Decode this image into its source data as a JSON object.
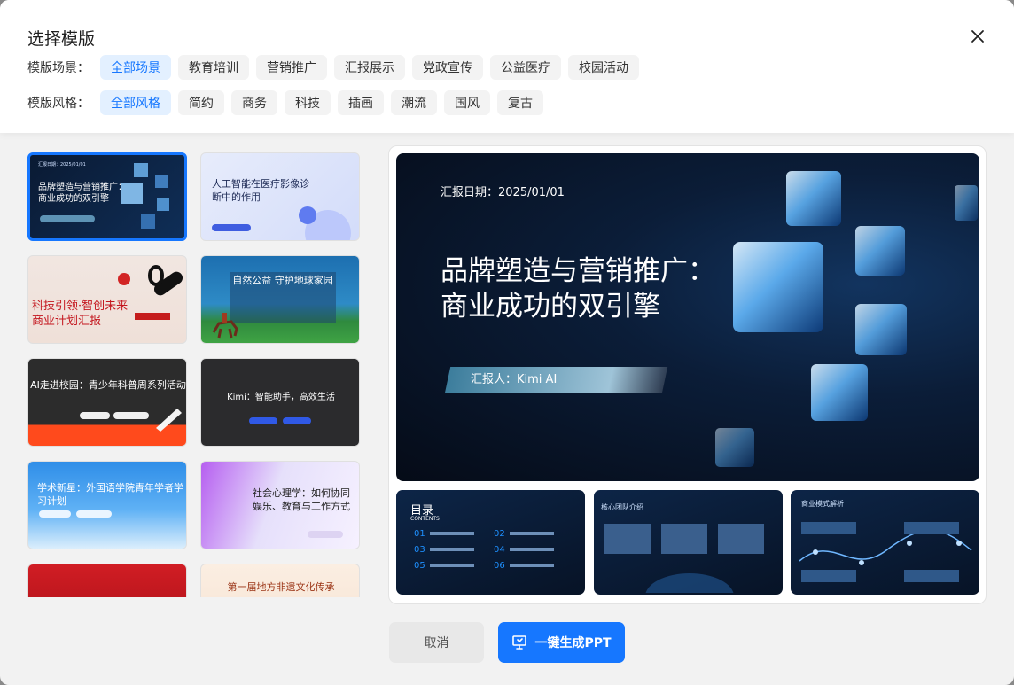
{
  "dialog": {
    "title": "选择模版"
  },
  "filters": {
    "scene_label": "模版场景：",
    "scenes": [
      "全部场景",
      "教育培训",
      "营销推广",
      "汇报展示",
      "党政宣传",
      "公益医疗",
      "校园活动"
    ],
    "style_label": "模版风格：",
    "styles": [
      "全部风格",
      "简约",
      "商务",
      "科技",
      "插画",
      "潮流",
      "国风",
      "复古"
    ]
  },
  "templates": [
    {
      "title": "品牌塑造与营销推广：商业成功的双引擎",
      "date": "汇报日期：2025/01/01"
    },
    {
      "title": "人工智能在医疗影像诊断中的作用"
    },
    {
      "title": "科技引领·智创未来 商业计划汇报"
    },
    {
      "title": "自然公益 守护地球家园"
    },
    {
      "title": "AI走进校园：青少年科普周系列活动"
    },
    {
      "title": "Kimi：智能助手，高效生活"
    },
    {
      "title": "学术新星：外国语学院青年学者学习计划"
    },
    {
      "title": "社会心理学：如何协同娱乐、教育与工作方式"
    },
    {
      "title": ""
    },
    {
      "title": "第一届地方非遗文化传承"
    }
  ],
  "preview": {
    "date": "汇报日期：2025/01/01",
    "title": "品牌塑造与营销推广：商业成功的双引擎",
    "reporter": "汇报人：Kimi AI",
    "mini_slides": [
      {
        "title": "目录",
        "subtitle": "CONTENTS"
      },
      {
        "title": "核心团队介绍"
      },
      {
        "title": "商业模式解析"
      }
    ]
  },
  "buttons": {
    "cancel": "取消",
    "generate": "一键生成PPT"
  }
}
